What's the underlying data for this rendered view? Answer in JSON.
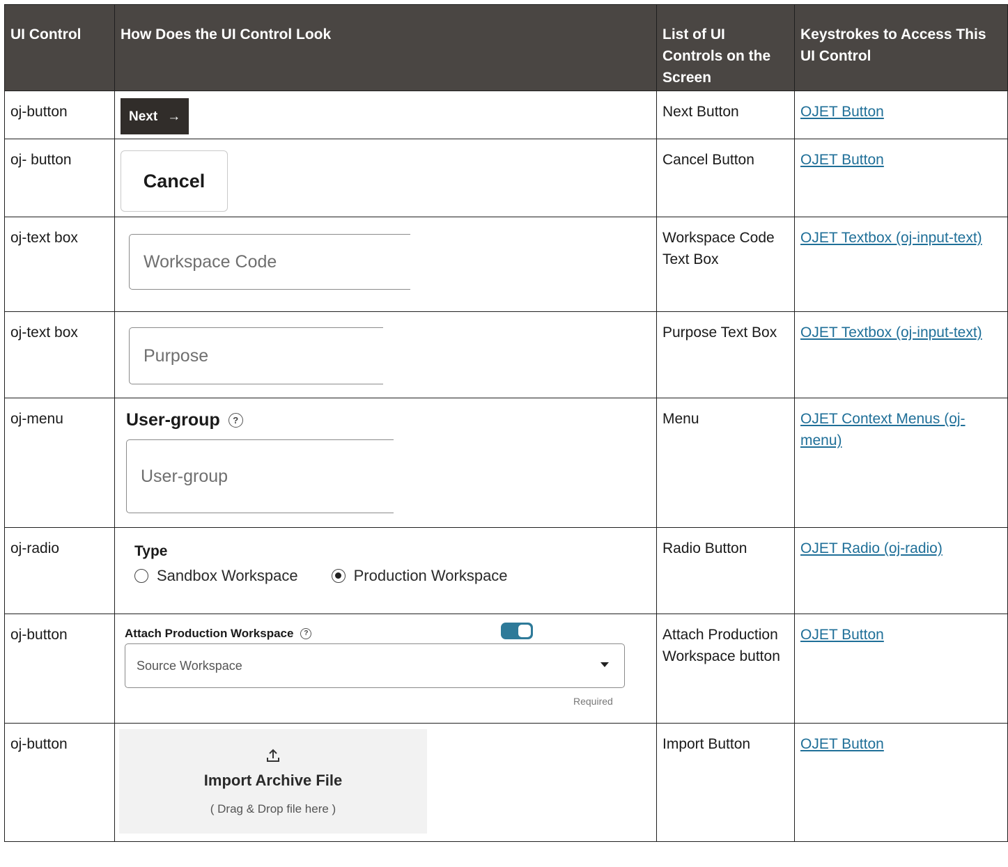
{
  "headers": [
    "UI Control",
    "How Does the UI Control Look",
    "List of UI Controls on the Screen",
    "Keystrokes to Access This UI Control"
  ],
  "rows": [
    {
      "control": "oj-button",
      "list": "Next Button",
      "link": "OJET Button"
    },
    {
      "control": "oj- button",
      "list": "Cancel Button",
      "link": "OJET  Button "
    },
    {
      "control": "oj-text box",
      "list": "Workspace Code Text Box",
      "link": "OJET Textbox (oj-input-text)"
    },
    {
      "control": "oj-text box",
      "list": "Purpose Text Box",
      "link": "OJET Textbox (oj-input-text)"
    },
    {
      "control": "oj-menu",
      "list": "Menu",
      "link": "OJET Context Menus (oj-menu)"
    },
    {
      "control": "oj-radio",
      "list": "Radio Button",
      "link": "OJET Radio (oj-radio)"
    },
    {
      "control": "oj-button",
      "list": "Attach Production Workspace button",
      "link": "OJET  Button "
    },
    {
      "control": "oj-button",
      "list": "Import Button",
      "link": "OJET  Button "
    }
  ],
  "samples": {
    "next": {
      "label": "Next",
      "arrow": "→"
    },
    "cancel": {
      "label": "Cancel"
    },
    "workspace_code": {
      "placeholder": "Workspace Code"
    },
    "purpose": {
      "placeholder": "Purpose"
    },
    "user_group": {
      "label": "User-group",
      "help": "?",
      "placeholder": "User-group"
    },
    "radio": {
      "type_label": "Type",
      "option1": "Sandbox Workspace",
      "option2": "Production Workspace",
      "selected": "Production Workspace"
    },
    "attach": {
      "label": "Attach Production Workspace",
      "help": "?",
      "toggle_on": true,
      "select_placeholder": "Source Workspace",
      "required": "Required"
    },
    "import": {
      "title": "Import Archive File",
      "subtitle": "( Drag & Drop file here )"
    }
  },
  "colors": {
    "header_bg": "#4a4643",
    "link": "#1f6f98",
    "next_bg": "#312d2a",
    "toggle": "#2e7a99"
  }
}
